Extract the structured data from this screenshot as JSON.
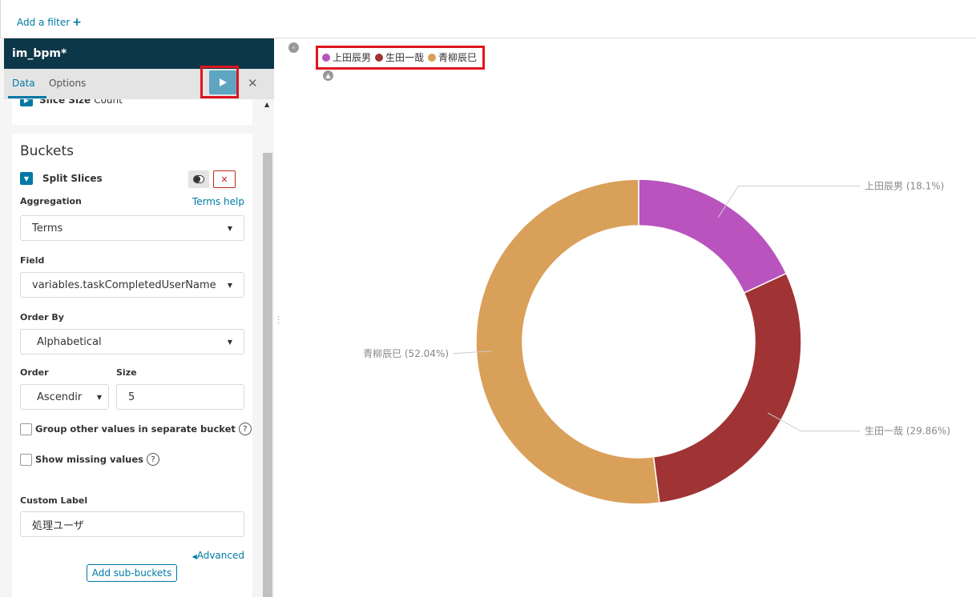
{
  "filter_bar": {
    "add_filter_label": "Add a filter"
  },
  "sidebar": {
    "title": "im_bpm*",
    "tabs": [
      {
        "label": "Data"
      },
      {
        "label": "Options"
      }
    ],
    "metric": {
      "label": "Slice Size",
      "value": "Count"
    },
    "buckets": {
      "title": "Buckets",
      "split_label": "Split Slices",
      "aggregation_label": "Aggregation",
      "terms_help": "Terms help",
      "aggregation_value": "Terms",
      "field_label": "Field",
      "field_value": "variables.taskCompletedUserName",
      "order_by_label": "Order By",
      "order_by_value": "Alphabetical",
      "order_label": "Order",
      "order_value": "Ascendir",
      "size_label": "Size",
      "size_value": "5",
      "group_other_label": "Group other values in separate bucket",
      "show_missing_label": "Show missing values",
      "custom_label_label": "Custom Label",
      "custom_label_value": "処理ユーザ",
      "advanced_label": "Advanced",
      "add_sub_buckets_label": "Add sub-buckets"
    }
  },
  "legend": [
    {
      "label": "上田辰男",
      "color": "#b953be"
    },
    {
      "label": "生田一哉",
      "color": "#a03333"
    },
    {
      "label": "青柳辰巳",
      "color": "#d9a05a"
    }
  ],
  "chart_data": {
    "type": "pie",
    "donut": true,
    "slices": [
      {
        "label": "上田辰男",
        "percent": 18.1,
        "display": "上田辰男 (18.1%)",
        "color": "#b953be"
      },
      {
        "label": "生田一哉",
        "percent": 29.86,
        "display": "生田一哉 (29.86%)",
        "color": "#a03333"
      },
      {
        "label": "青柳辰巳",
        "percent": 52.04,
        "display": "青柳辰巳 (52.04%)",
        "color": "#d9a05a"
      }
    ]
  }
}
